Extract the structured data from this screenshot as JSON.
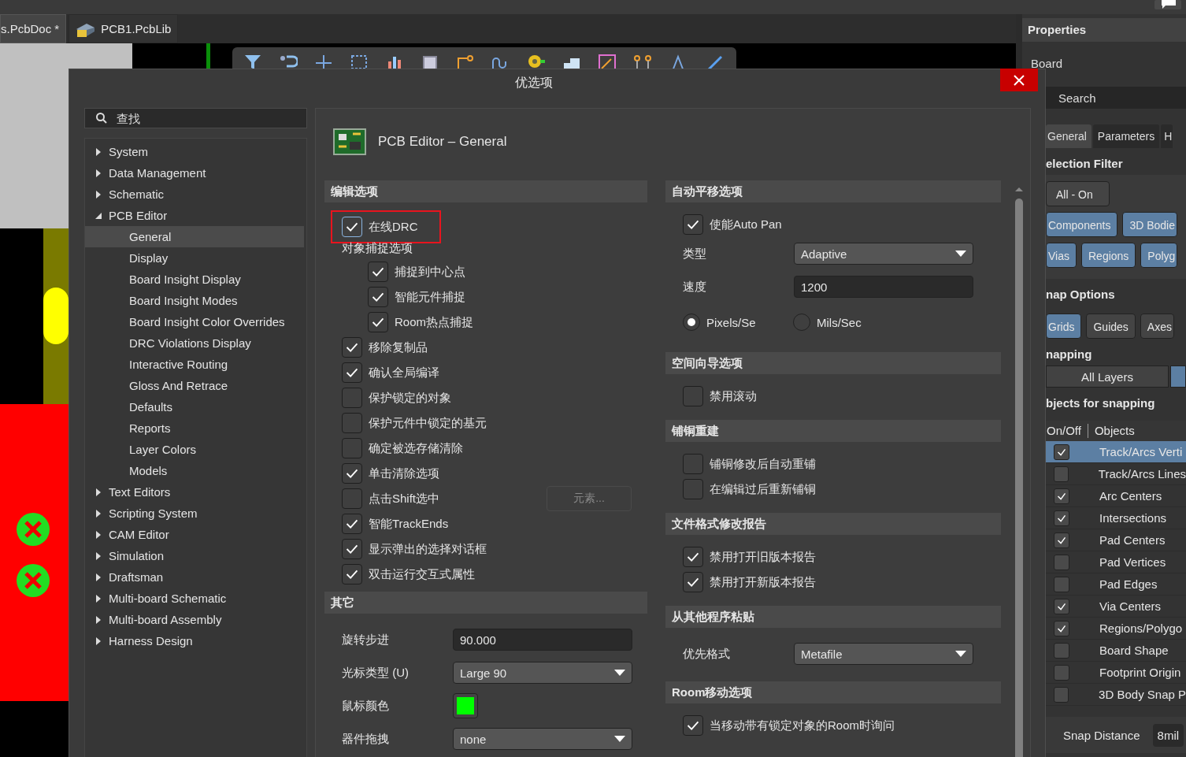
{
  "app": {
    "tabs": [
      {
        "label": "s.PcbDoc *",
        "selected": true,
        "kind": "pcb_doc"
      },
      {
        "label": "PCB1.PcbLib",
        "selected": false,
        "kind": "pcb_lib"
      }
    ]
  },
  "dialog": {
    "title": "优选项",
    "search": {
      "placeholder": "查找"
    },
    "tree": [
      {
        "label": "System",
        "expanded": false,
        "selected": false
      },
      {
        "label": "Data Management",
        "expanded": false,
        "selected": false
      },
      {
        "label": "Schematic",
        "expanded": false,
        "selected": false
      },
      {
        "label": "PCB Editor",
        "expanded": true,
        "selected": false,
        "children": [
          {
            "label": "General",
            "selected": true
          },
          {
            "label": "Display",
            "selected": false
          },
          {
            "label": "Board Insight Display",
            "selected": false
          },
          {
            "label": "Board Insight Modes",
            "selected": false
          },
          {
            "label": "Board Insight Color Overrides",
            "selected": false
          },
          {
            "label": "DRC Violations Display",
            "selected": false
          },
          {
            "label": "Interactive Routing",
            "selected": false
          },
          {
            "label": "Gloss And Retrace",
            "selected": false
          },
          {
            "label": "Defaults",
            "selected": false
          },
          {
            "label": "Reports",
            "selected": false
          },
          {
            "label": "Layer Colors",
            "selected": false
          },
          {
            "label": "Models",
            "selected": false
          }
        ]
      },
      {
        "label": "Text Editors",
        "expanded": false,
        "selected": false
      },
      {
        "label": "Scripting System",
        "expanded": false,
        "selected": false
      },
      {
        "label": "CAM Editor",
        "expanded": false,
        "selected": false
      },
      {
        "label": "Simulation",
        "expanded": false,
        "selected": false
      },
      {
        "label": "Draftsman",
        "expanded": false,
        "selected": false
      },
      {
        "label": "Multi-board Schematic",
        "expanded": false,
        "selected": false
      },
      {
        "label": "Multi-board Assembly",
        "expanded": false,
        "selected": false
      },
      {
        "label": "Harness Design",
        "expanded": false,
        "selected": false
      }
    ],
    "page_title": "PCB Editor – General",
    "columns": [
      {
        "sections": [
          {
            "heading": "编辑选项",
            "items": [
              {
                "kind": "checkbox",
                "label": "在线DRC",
                "checked": true,
                "highlighted": true
              },
              {
                "kind": "label",
                "label": "对象捕捉选项",
                "children": [
                  {
                    "kind": "checkbox",
                    "label": "捕捉到中心点",
                    "checked": true
                  },
                  {
                    "kind": "checkbox",
                    "label": "智能元件捕捉",
                    "checked": true
                  },
                  {
                    "kind": "checkbox",
                    "label": "Room热点捕捉",
                    "checked": true
                  }
                ]
              },
              {
                "kind": "checkbox",
                "label": "移除复制品",
                "checked": true
              },
              {
                "kind": "checkbox",
                "label": "确认全局编译",
                "checked": true
              },
              {
                "kind": "checkbox",
                "label": "保护锁定的对象",
                "checked": false
              },
              {
                "kind": "checkbox",
                "label": "保护元件中锁定的基元",
                "checked": false
              },
              {
                "kind": "checkbox",
                "label": "确定被选存储清除",
                "checked": false
              },
              {
                "kind": "checkbox",
                "label": "单击清除选项",
                "checked": true
              },
              {
                "kind": "checkbox",
                "label": "点击Shift选中",
                "checked": false,
                "button": {
                  "label": "元素...",
                  "disabled": true
                }
              },
              {
                "kind": "checkbox",
                "label": "智能TrackEnds",
                "checked": true
              },
              {
                "kind": "checkbox",
                "label": "显示弹出的选择对话框",
                "checked": true
              },
              {
                "kind": "checkbox",
                "label": "双击运行交互式属性",
                "checked": true
              }
            ]
          },
          {
            "heading": "其它",
            "items": [
              {
                "kind": "input",
                "label": "旋转步进",
                "value": "90.000"
              },
              {
                "kind": "dropdown",
                "label": "光标类型 (U)",
                "value": "Large 90"
              },
              {
                "kind": "color",
                "label": "鼠标颜色",
                "color": "#00ff00"
              },
              {
                "kind": "dropdown",
                "label": "器件拖拽",
                "value": "none"
              }
            ]
          }
        ]
      },
      {
        "sections": [
          {
            "heading": "自动平移选项",
            "items": [
              {
                "kind": "checkbox",
                "label": "使能Auto Pan",
                "checked": true
              },
              {
                "kind": "dropdown",
                "label": "类型",
                "value": "Adaptive"
              },
              {
                "kind": "input",
                "label": "速度",
                "value": "1200"
              },
              {
                "kind": "radio_group",
                "options": [
                  {
                    "label": "Pixels/Se",
                    "selected": true
                  },
                  {
                    "label": "Mils/Sec",
                    "selected": false
                  }
                ]
              }
            ]
          },
          {
            "heading": "空间向导选项",
            "items": [
              {
                "kind": "checkbox",
                "label": "禁用滚动",
                "checked": false
              }
            ]
          },
          {
            "heading": "铺铜重建",
            "items": [
              {
                "kind": "checkbox",
                "label": "铺铜修改后自动重铺",
                "checked": false
              },
              {
                "kind": "checkbox",
                "label": "在编辑过后重新铺铜",
                "checked": false
              }
            ]
          },
          {
            "heading": "文件格式修改报告",
            "items": [
              {
                "kind": "checkbox",
                "label": "禁用打开旧版本报告",
                "checked": true
              },
              {
                "kind": "checkbox",
                "label": "禁用打开新版本报告",
                "checked": true
              }
            ]
          },
          {
            "heading": "从其他程序粘贴",
            "items": [
              {
                "kind": "dropdown",
                "label": "优先格式",
                "value": "Metafile"
              }
            ]
          },
          {
            "heading": "Room移动选项",
            "items": [
              {
                "kind": "checkbox",
                "label": "当移动带有锁定对象的Room时询问",
                "checked": true
              }
            ]
          }
        ]
      }
    ]
  },
  "properties": {
    "title": "Properties",
    "object": "Board",
    "search": {
      "placeholder": "Search"
    },
    "tabs": [
      {
        "label": "General",
        "selected": true
      },
      {
        "label": "Parameters",
        "selected": false
      },
      {
        "label": "H",
        "selected": false
      }
    ],
    "filter_heading": "election Filter",
    "filter_rows": [
      {
        "buttons": [
          {
            "label": "All - On",
            "on": false
          }
        ]
      },
      {
        "buttons": [
          {
            "label": "Components",
            "on": true
          },
          {
            "label": "3D Bodie",
            "on": true
          }
        ]
      },
      {
        "buttons": [
          {
            "label": "Vias",
            "on": true
          },
          {
            "label": "Regions",
            "on": true
          },
          {
            "label": "Polyg",
            "on": true
          }
        ]
      }
    ],
    "snap_heading": "nap Options",
    "snap_buttons": [
      {
        "label": "Grids",
        "on": true
      },
      {
        "label": "Guides",
        "on": false
      },
      {
        "label": "Axes",
        "on": false
      }
    ],
    "snapping_heading": "napping",
    "snapping_modes": [
      {
        "label": "All Layers",
        "selected": false
      },
      {
        "selected": true
      }
    ],
    "objects_heading": "bjects for snapping",
    "objects_columns": [
      "On/Off",
      "Objects"
    ],
    "objects": [
      {
        "label": "Track/Arcs Verti",
        "checked": true,
        "selected": true
      },
      {
        "label": "Track/Arcs Lines",
        "checked": false,
        "selected": false
      },
      {
        "label": "Arc Centers",
        "checked": true,
        "selected": false
      },
      {
        "label": "Intersections",
        "checked": true,
        "selected": false
      },
      {
        "label": "Pad Centers",
        "checked": true,
        "selected": false
      },
      {
        "label": "Pad Vertices",
        "checked": false,
        "selected": false
      },
      {
        "label": "Pad Edges",
        "checked": false,
        "selected": false
      },
      {
        "label": "Via Centers",
        "checked": true,
        "selected": false
      },
      {
        "label": "Regions/Polygo",
        "checked": true,
        "selected": false
      },
      {
        "label": "Board Shape",
        "checked": false,
        "selected": false
      },
      {
        "label": "Footprint Origin",
        "checked": false,
        "selected": false
      },
      {
        "label": "3D Body Snap P",
        "checked": false,
        "selected": false
      }
    ],
    "snap_distance": {
      "label": "Snap Distance",
      "value": "8mil"
    }
  }
}
